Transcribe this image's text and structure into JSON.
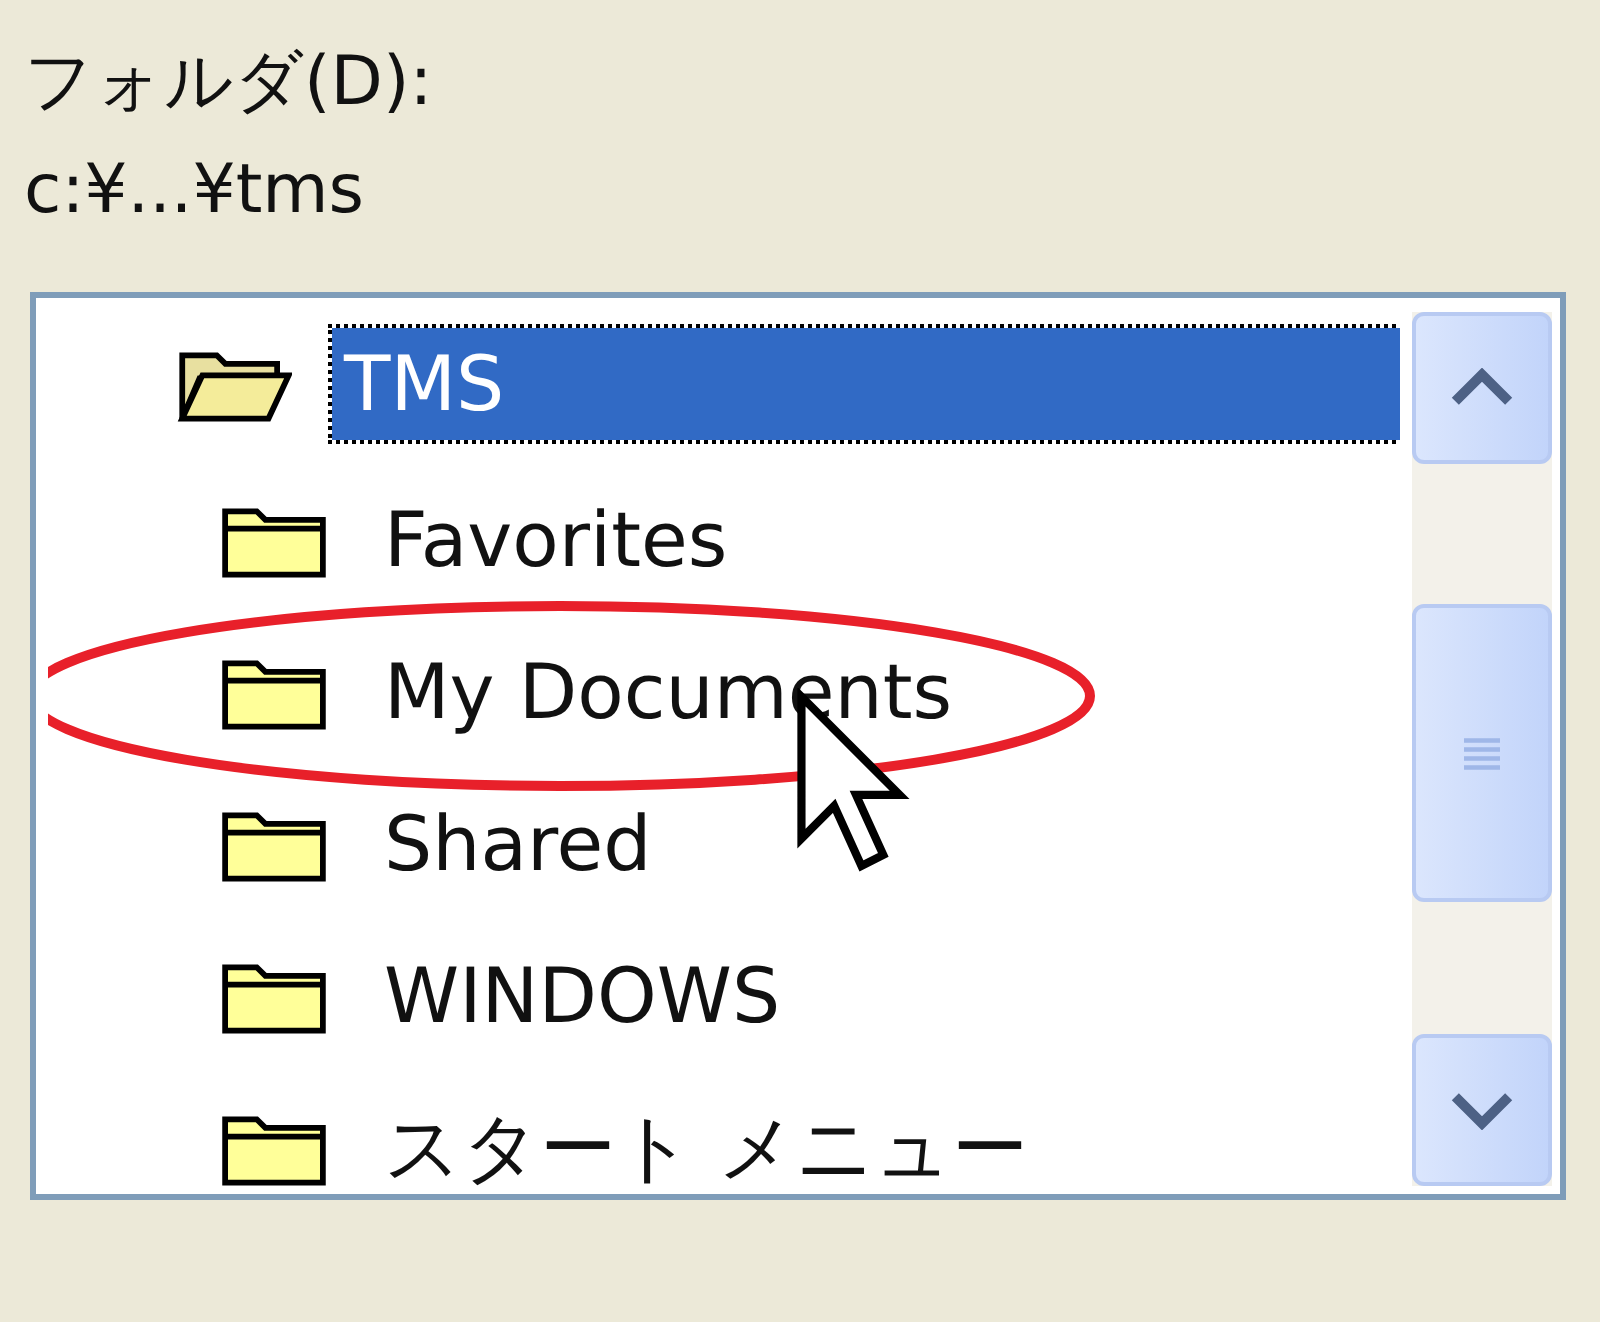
{
  "label": "フォルダ(D):",
  "path": "c:¥...¥tms",
  "folder_tree": [
    {
      "name": "TMS",
      "selected": true,
      "expanded": true,
      "children": [
        {
          "name": "Favorites",
          "selected": false,
          "expanded": false,
          "circled": false
        },
        {
          "name": "My Documents",
          "selected": false,
          "expanded": false,
          "circled": true
        },
        {
          "name": "Shared",
          "selected": false,
          "expanded": false,
          "circled": false
        },
        {
          "name": "WINDOWS",
          "selected": false,
          "expanded": false,
          "circled": false
        },
        {
          "name": "スタート メニュー",
          "selected": false,
          "expanded": false,
          "circled": false
        }
      ]
    }
  ]
}
